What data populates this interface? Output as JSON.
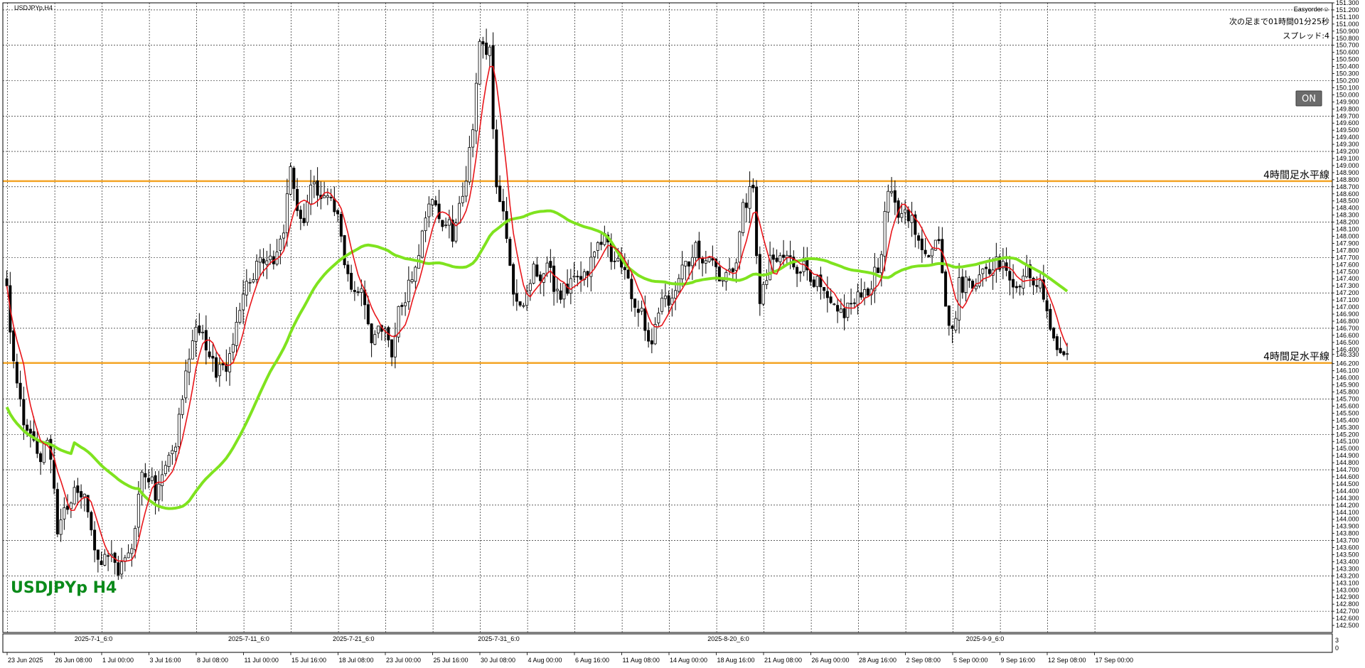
{
  "window": {
    "symbol_label": "USDJPYp,H4",
    "big_label": "USDJPYp H4",
    "ea_name": "Easyorder☺",
    "countdown": "次の足まで01時間01分25秒",
    "spread": "スプレッド:4",
    "on_button": "ON",
    "colors": {
      "bullish": "#000000",
      "bearish": "#000000",
      "ma_fast": "#e8161b",
      "ma_slow": "#7fe31f",
      "level": "#f4a426",
      "grid": "#000000",
      "big_label": "#0a8a1a"
    }
  },
  "sub_panel": {
    "top_label": "3",
    "bottom_label": "0"
  },
  "chart_data": {
    "type": "candlestick",
    "symbol": "USDJPYp",
    "timeframe": "H4",
    "y_range": [
      142.4,
      151.3
    ],
    "y_ticks": [
      "151.300",
      "151.200",
      "151.100",
      "151.000",
      "150.900",
      "150.800",
      "150.700",
      "150.600",
      "150.500",
      "150.400",
      "150.300",
      "150.200",
      "150.100",
      "150.000",
      "149.900",
      "149.800",
      "149.700",
      "149.600",
      "149.500",
      "149.400",
      "149.300",
      "149.200",
      "149.100",
      "149.000",
      "148.900",
      "148.800",
      "148.700",
      "148.600",
      "148.500",
      "148.400",
      "148.300",
      "148.200",
      "148.100",
      "148.000",
      "147.900",
      "147.800",
      "147.700",
      "147.600",
      "147.500",
      "147.400",
      "147.300",
      "147.200",
      "147.100",
      "147.000",
      "146.900",
      "146.800",
      "146.700",
      "146.600",
      "146.500",
      "146.400",
      "146.330",
      "146.200",
      "146.100",
      "146.000",
      "145.900",
      "145.800",
      "145.700",
      "145.600",
      "145.500",
      "145.400",
      "145.300",
      "145.200",
      "145.100",
      "145.000",
      "144.900",
      "144.800",
      "144.700",
      "144.600",
      "144.500",
      "144.400",
      "144.300",
      "144.200",
      "144.100",
      "144.000",
      "143.900",
      "143.800",
      "143.700",
      "143.600",
      "143.500",
      "143.400",
      "143.300",
      "143.200",
      "143.100",
      "143.000",
      "142.900",
      "142.800",
      "142.700",
      "142.600",
      "142.500"
    ],
    "x_labels": [
      {
        "label": "23 Jun 2025",
        "bar": 0
      },
      {
        "label": "26 Jun 08:00",
        "bar": 14
      },
      {
        "label": "1 Jul 00:00",
        "bar": 28
      },
      {
        "label": "3 Jul 16:00",
        "bar": 42
      },
      {
        "label": "8 Jul 08:00",
        "bar": 56
      },
      {
        "label": "11 Jul 00:00",
        "bar": 70
      },
      {
        "label": "15 Jul 16:00",
        "bar": 84
      },
      {
        "label": "18 Jul 08:00",
        "bar": 98
      },
      {
        "label": "23 Jul 00:00",
        "bar": 112
      },
      {
        "label": "25 Jul 16:00",
        "bar": 126
      },
      {
        "label": "30 Jul 08:00",
        "bar": 140
      },
      {
        "label": "4 Aug 00:00",
        "bar": 154
      },
      {
        "label": "6 Aug 16:00",
        "bar": 168
      },
      {
        "label": "11 Aug 08:00",
        "bar": 182
      },
      {
        "label": "14 Aug 00:00",
        "bar": 196
      },
      {
        "label": "18 Aug 16:00",
        "bar": 210
      },
      {
        "label": "21 Aug 08:00",
        "bar": 224
      },
      {
        "label": "26 Aug 00:00",
        "bar": 238
      },
      {
        "label": "28 Aug 16:00",
        "bar": 252
      },
      {
        "label": "2 Sep 08:00",
        "bar": 266
      },
      {
        "label": "5 Sep 00:00",
        "bar": 280
      },
      {
        "label": "9 Sep 16:00",
        "bar": 294
      },
      {
        "label": "12 Sep 08:00",
        "bar": 308
      },
      {
        "label": "17 Sep 00:00",
        "bar": 322
      }
    ],
    "period_separators": [
      {
        "label": "2025-7-1_6:0",
        "bar": 26
      },
      {
        "label": "2025-7-11_6:0",
        "bar": 72
      },
      {
        "label": "2025-7-21_6:0",
        "bar": 103
      },
      {
        "label": "2025-7-31_6:0",
        "bar": 146
      },
      {
        "label": "2025-8-20_6:0",
        "bar": 214
      },
      {
        "label": "2025-9-9_6:0",
        "bar": 290
      }
    ],
    "horizontal_levels": [
      {
        "price": 148.78,
        "label": "4時間足水平線"
      },
      {
        "price": 146.21,
        "label": "4時間足水平線"
      }
    ],
    "close_anchors": [
      [
        0,
        147.3
      ],
      [
        2,
        146.1
      ],
      [
        6,
        145.2
      ],
      [
        10,
        144.9
      ],
      [
        12,
        145.2
      ],
      [
        15,
        143.9
      ],
      [
        18,
        144.2
      ],
      [
        21,
        144.4
      ],
      [
        24,
        144.2
      ],
      [
        27,
        143.3
      ],
      [
        30,
        143.5
      ],
      [
        33,
        143.2
      ],
      [
        36,
        143.5
      ],
      [
        38,
        143.9
      ],
      [
        40,
        144.7
      ],
      [
        44,
        144.4
      ],
      [
        47,
        144.9
      ],
      [
        50,
        145.1
      ],
      [
        53,
        146.0
      ],
      [
        56,
        146.7
      ],
      [
        58,
        146.6
      ],
      [
        62,
        146.0
      ],
      [
        66,
        146.3
      ],
      [
        70,
        147.1
      ],
      [
        74,
        147.6
      ],
      [
        78,
        147.6
      ],
      [
        82,
        148.1
      ],
      [
        84,
        148.9
      ],
      [
        86,
        148.5
      ],
      [
        88,
        148.1
      ],
      [
        90,
        148.7
      ],
      [
        93,
        148.6
      ],
      [
        96,
        148.5
      ],
      [
        98,
        148.2
      ],
      [
        102,
        147.2
      ],
      [
        105,
        147.3
      ],
      [
        108,
        146.6
      ],
      [
        112,
        146.6
      ],
      [
        114,
        146.3
      ],
      [
        116,
        146.9
      ],
      [
        120,
        147.5
      ],
      [
        123,
        148.0
      ],
      [
        126,
        148.6
      ],
      [
        128,
        148.3
      ],
      [
        130,
        148.2
      ],
      [
        132,
        148.0
      ],
      [
        135,
        148.5
      ],
      [
        138,
        149.5
      ],
      [
        140,
        150.7
      ],
      [
        143,
        150.6
      ],
      [
        145,
        148.7
      ],
      [
        147,
        148.3
      ],
      [
        150,
        147.2
      ],
      [
        153,
        146.9
      ],
      [
        156,
        147.5
      ],
      [
        160,
        147.5
      ],
      [
        164,
        147.2
      ],
      [
        168,
        147.3
      ],
      [
        172,
        147.5
      ],
      [
        176,
        148.0
      ],
      [
        180,
        147.7
      ],
      [
        184,
        147.3
      ],
      [
        188,
        146.9
      ],
      [
        191,
        146.4
      ],
      [
        193,
        147.0
      ],
      [
        196,
        147.1
      ],
      [
        200,
        147.6
      ],
      [
        204,
        147.8
      ],
      [
        208,
        147.7
      ],
      [
        212,
        147.4
      ],
      [
        216,
        147.6
      ],
      [
        218,
        148.5
      ],
      [
        221,
        148.6
      ],
      [
        223,
        147.0
      ],
      [
        226,
        147.6
      ],
      [
        230,
        147.7
      ],
      [
        234,
        147.6
      ],
      [
        238,
        147.5
      ],
      [
        242,
        147.1
      ],
      [
        246,
        146.9
      ],
      [
        250,
        147.0
      ],
      [
        254,
        147.2
      ],
      [
        258,
        147.5
      ],
      [
        261,
        148.6
      ],
      [
        264,
        148.3
      ],
      [
        266,
        148.5
      ],
      [
        270,
        147.9
      ],
      [
        274,
        147.8
      ],
      [
        276,
        148.0
      ],
      [
        278,
        147.1
      ],
      [
        280,
        146.6
      ],
      [
        282,
        147.3
      ],
      [
        285,
        147.4
      ],
      [
        288,
        147.4
      ],
      [
        292,
        147.6
      ],
      [
        295,
        147.7
      ],
      [
        297,
        147.4
      ],
      [
        300,
        147.4
      ],
      [
        303,
        147.5
      ],
      [
        306,
        147.3
      ],
      [
        308,
        147.0
      ],
      [
        311,
        146.4
      ],
      [
        314,
        146.3
      ]
    ],
    "ma_fast_period": 20,
    "ma_slow_period": 200
  }
}
